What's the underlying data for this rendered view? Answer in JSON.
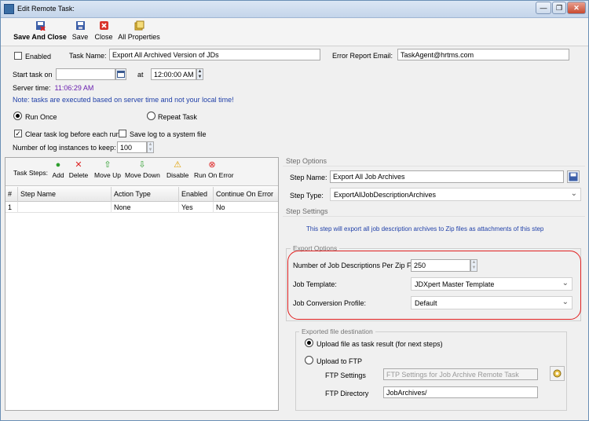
{
  "window": {
    "title": "Edit Remote Task:",
    "controls": {
      "minimize": "—",
      "restore": "❐",
      "close": "✕"
    }
  },
  "toolbar": {
    "save_and_close": "Save And Close",
    "save": "Save",
    "close": "Close",
    "all_properties": "All Properties"
  },
  "task": {
    "enabled_label": "Enabled",
    "enabled_checked": false,
    "name_label": "Task Name:",
    "name_value": "Export All Archived Version of JDs",
    "error_email_label": "Error Report Email:",
    "error_email_value": "TaskAgent@hrtms.com",
    "start_label": "Start task on",
    "start_date_value": "",
    "at_label": "at",
    "start_time_value": "12:00:00 AM",
    "server_time_label": "Server time:",
    "server_time_value": "11:06:29 AM",
    "note": "Note: tasks are executed based on server time and not your local time!",
    "run_once_label": "Run Once",
    "repeat_label": "Repeat Task",
    "clear_log_label": "Clear task log before each run",
    "clear_log_checked": true,
    "save_log_label": "Save log to a system file",
    "save_log_checked": false,
    "log_instances_label": "Number of log instances to keep:",
    "log_instances_value": "100"
  },
  "steps_toolbar": {
    "label": "Task Steps:",
    "add": "Add",
    "delete": "Delete",
    "move_up": "Move Up",
    "move_down": "Move Down",
    "disable": "Disable",
    "run_on_error": "Run On Error"
  },
  "steps_grid": {
    "columns": [
      "#",
      "Step Name",
      "Action Type",
      "Enabled",
      "Continue On Error"
    ],
    "rows": [
      [
        "1",
        "",
        "None",
        "Yes",
        "No"
      ]
    ]
  },
  "step_options": {
    "header": "Step Options",
    "name_label": "Step Name:",
    "name_value": "Export All Job Archives",
    "type_label": "Step Type:",
    "type_value": "ExportAllJobDescriptionArchives"
  },
  "step_settings": {
    "header": "Step Settings",
    "description": "This step will export all job description archives to Zip files as attachments of this step"
  },
  "export_options": {
    "legend": "Export Options",
    "per_zip_label": "Number of Job Descriptions Per Zip File:",
    "per_zip_value": "250",
    "template_label": "Job Template:",
    "template_value": "JDXpert Master Template",
    "profile_label": "Job Conversion Profile:",
    "profile_value": "Default"
  },
  "destination": {
    "legend": "Exported file destination",
    "upload_task_label": "Upload file as task result (for next steps)",
    "upload_ftp_label": "Upload to FTP",
    "ftp_settings_label": "FTP Settings",
    "ftp_settings_value": "FTP Settings for Job Archive Remote Task",
    "ftp_dir_label": "FTP Directory",
    "ftp_dir_value": "JobArchives/"
  },
  "colors": {
    "note_blue": "#1f3fa8",
    "server_time_purple": "#6a1fb0",
    "highlight_red": "#e02020"
  }
}
